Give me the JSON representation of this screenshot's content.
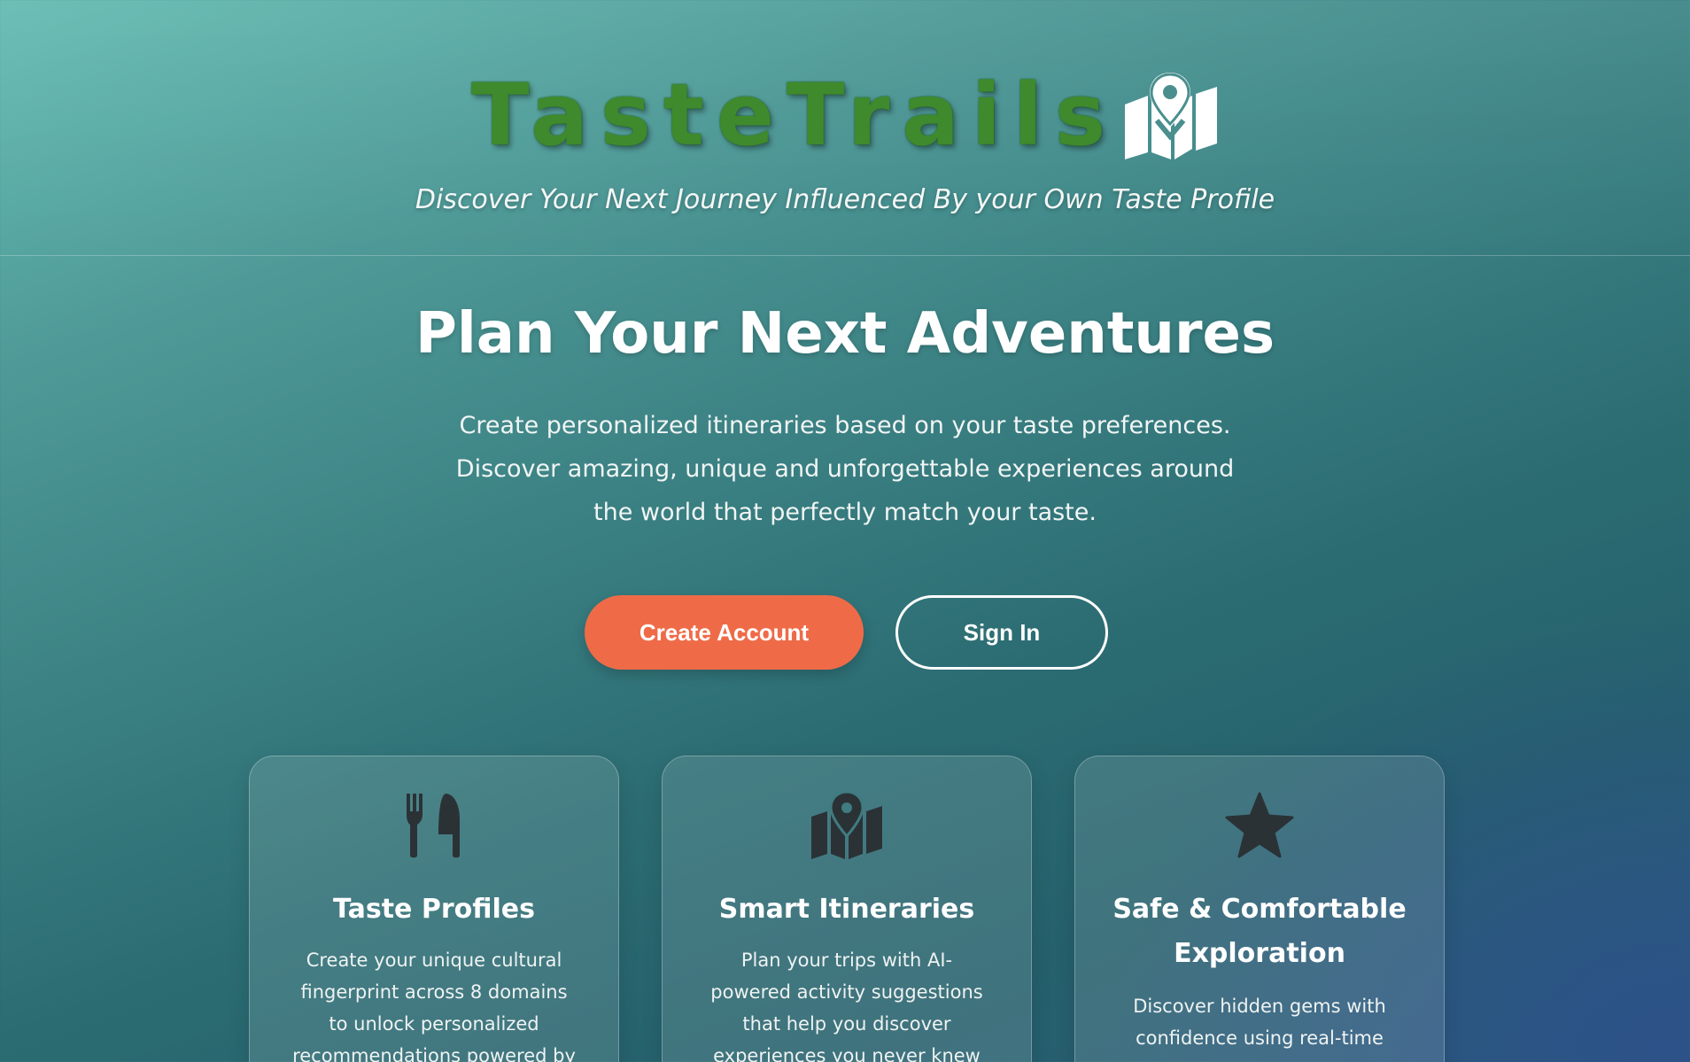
{
  "header": {
    "logo_text": "TasteTrails",
    "tagline": "Discover Your Next Journey Influenced By your Own Taste Profile",
    "logo_icon": "map-pin-icon"
  },
  "hero": {
    "title": "Plan Your Next Adventures",
    "description": "Create personalized itineraries based on your taste preferences. Discover amazing, unique and unforgettable experiences around the world that perfectly match your taste.",
    "create_account_label": "Create Account",
    "sign_in_label": "Sign In"
  },
  "features": [
    {
      "icon": "utensils-icon",
      "title": "Taste Profiles",
      "text": "Create your unique cultural fingerprint across 8 domains to unlock personalized recommendations powered by"
    },
    {
      "icon": "map-location-icon",
      "title": "Smart Itineraries",
      "text": "Plan your trips with AI-powered activity suggestions that help you discover experiences you never knew you'd love"
    },
    {
      "icon": "star-icon",
      "title": "Safe & Comfortable Exploration",
      "text": "Discover hidden gems with confidence using real-time"
    }
  ],
  "colors": {
    "primary_button": "#ef6b48",
    "logo_green": "#3f8a2c",
    "icon_dark": "#2b3236"
  }
}
